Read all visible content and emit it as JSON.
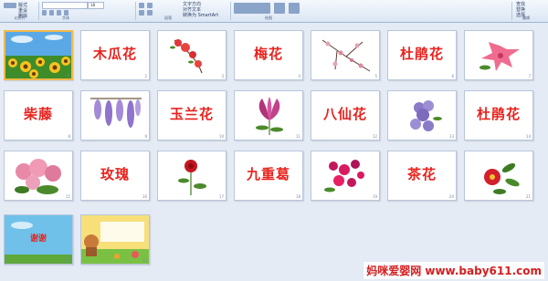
{
  "ribbon": {
    "font_size": "18",
    "groups": [
      "幻灯片",
      "字体",
      "段落",
      "绘图",
      "编辑"
    ],
    "items": [
      "版式",
      "重设",
      "删除",
      "文字方向",
      "对齐文本",
      "转换为 SmartArt",
      "查找",
      "替换",
      "选择"
    ]
  },
  "slides": [
    {
      "id": "1",
      "kind": "photo",
      "caption": "",
      "image": "sunflower-field"
    },
    {
      "id": "2",
      "kind": "title",
      "caption": "木瓜花"
    },
    {
      "id": "3",
      "kind": "photo",
      "image": "quince-flower"
    },
    {
      "id": "4",
      "kind": "title",
      "caption": "梅花"
    },
    {
      "id": "5",
      "kind": "photo",
      "image": "plum-branch"
    },
    {
      "id": "6",
      "kind": "title",
      "caption": "杜鹃花"
    },
    {
      "id": "7",
      "kind": "photo",
      "image": "azalea"
    },
    {
      "id": "8",
      "kind": "title",
      "caption": "柴藤"
    },
    {
      "id": "9",
      "kind": "photo",
      "image": "wisteria"
    },
    {
      "id": "10",
      "kind": "title",
      "caption": "玉兰花"
    },
    {
      "id": "11",
      "kind": "photo",
      "image": "magnolia"
    },
    {
      "id": "12",
      "kind": "title",
      "caption": "八仙花"
    },
    {
      "id": "13",
      "kind": "photo",
      "image": "hydrangea"
    },
    {
      "id": "14",
      "kind": "title",
      "caption": "杜鹃花"
    },
    {
      "id": "15",
      "kind": "photo",
      "image": "rhododendron"
    },
    {
      "id": "16",
      "kind": "title",
      "caption": "玫瑰"
    },
    {
      "id": "17",
      "kind": "photo",
      "image": "rose"
    },
    {
      "id": "18",
      "kind": "title",
      "caption": "九重葛"
    },
    {
      "id": "19",
      "kind": "photo",
      "image": "bougainvillea"
    },
    {
      "id": "20",
      "kind": "title",
      "caption": "茶花"
    },
    {
      "id": "21",
      "kind": "photo",
      "image": "camellia"
    },
    {
      "id": "22",
      "kind": "photo",
      "caption": "谢谢",
      "image": "sky-thanks"
    },
    {
      "id": "23",
      "kind": "photo",
      "image": "cartoon-scene"
    }
  ],
  "watermark": "妈咪爱婴网 www.baby611.com",
  "colors": {
    "title_red": "#e8231e",
    "selection": "#f2b84b",
    "background": "#e4ebf5"
  }
}
